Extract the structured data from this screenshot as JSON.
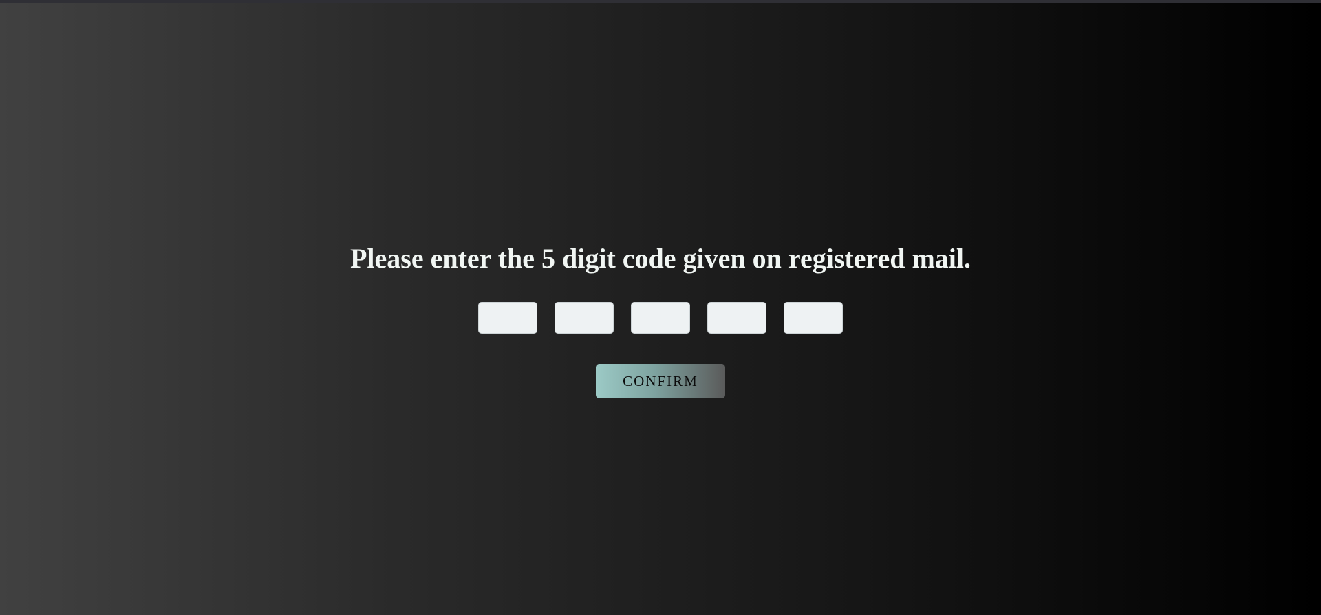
{
  "prompt": {
    "text": "Please enter the 5 digit code given on registered mail."
  },
  "code_inputs": [
    {
      "value": "",
      "placeholder": ""
    },
    {
      "value": "",
      "placeholder": ""
    },
    {
      "value": "",
      "placeholder": ""
    },
    {
      "value": "",
      "placeholder": ""
    },
    {
      "value": "",
      "placeholder": ""
    }
  ],
  "confirm": {
    "label": "CONFIRM"
  },
  "colors": {
    "prompt_text": "#f1f6f3",
    "input_background": "#eef2f3",
    "button_gradient_start": "#9ccac6",
    "button_gradient_end": "#5a5a5a",
    "background_left": "#414141",
    "background_right": "#000000"
  }
}
